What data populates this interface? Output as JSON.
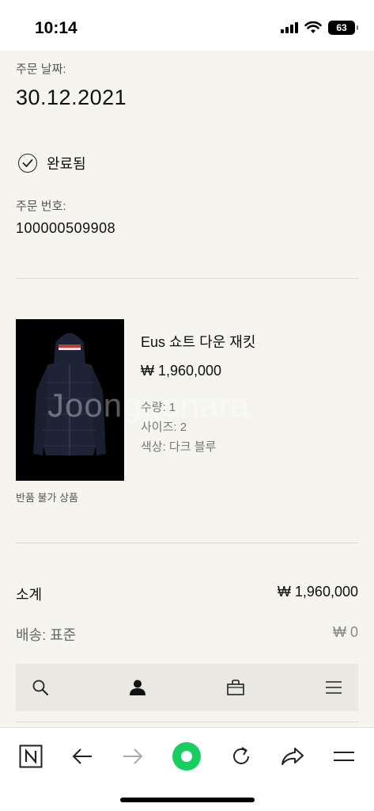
{
  "status_bar": {
    "time": "10:14",
    "battery": "63"
  },
  "order": {
    "date_label": "주문 날짜:",
    "date": "30.12.2021",
    "status": "완료됨",
    "number_label": "주문 번호:",
    "number": "100000509908"
  },
  "product": {
    "name": "Eus 쇼트 다운 재킷",
    "price": "₩ 1,960,000",
    "quantity": "수량: 1",
    "size": "사이즈: 2",
    "color": "색상: 다크 블루",
    "return_note": "반품 불가 상품"
  },
  "watermark": "Joonggonara",
  "summary": {
    "subtotal_label": "소계",
    "subtotal_value": "₩ 1,960,000",
    "shipping_label": "배송: 표준",
    "shipping_value": "₩ 0"
  },
  "app_nav": {
    "items": [
      "search-icon",
      "user-icon",
      "bag-icon",
      "menu-icon"
    ]
  },
  "browser_nav": {
    "items": [
      "naver-logo-icon",
      "back-arrow-icon",
      "forward-arrow-icon",
      "green-dot-icon",
      "refresh-icon",
      "share-icon",
      "hamburger-icon"
    ]
  }
}
